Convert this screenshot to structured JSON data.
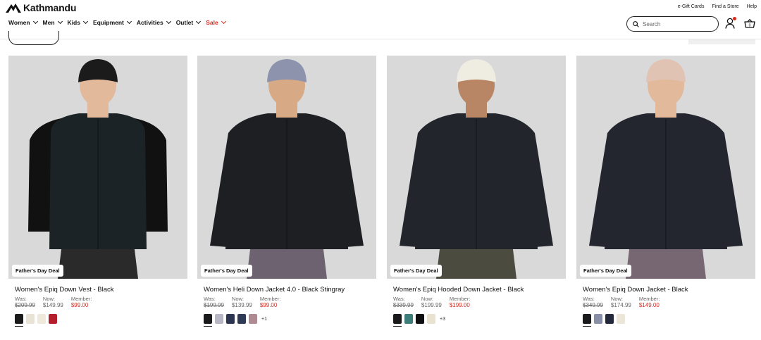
{
  "brand": {
    "name": "Kathmandu"
  },
  "utility_links": [
    "e-Gift Cards",
    "Find a Store",
    "Help"
  ],
  "nav": [
    {
      "label": "Women"
    },
    {
      "label": "Men"
    },
    {
      "label": "Kids"
    },
    {
      "label": "Equipment"
    },
    {
      "label": "Activities"
    },
    {
      "label": "Outlet"
    },
    {
      "label": "Sale"
    }
  ],
  "search": {
    "placeholder": "Search"
  },
  "colors": {
    "accent": "#d52b1e",
    "image_bg": "#d9d9d9"
  },
  "labels": {
    "was": "Was:",
    "now": "Now:",
    "member": "Member:"
  },
  "products": [
    {
      "badge": "Father's Day Deal",
      "title": "Women's Epiq Down Vest - Black",
      "was": "$209.99",
      "now": "$149.99",
      "member": "$99.00",
      "swatches": [
        "#1b1b1b",
        "#e9e3d6",
        "#efe9dc",
        "#b3202b"
      ],
      "more": "",
      "hat": "#1b1b1b",
      "top": "#1c2326",
      "pants": "#2a2a2a",
      "skin": "#e2b99b"
    },
    {
      "badge": "Father's Day Deal",
      "title": "Women's Heli Down Jacket 4.0 - Black Stingray",
      "was": "$199.99",
      "now": "$139.99",
      "member": "$99.00",
      "swatches": [
        "#1a1a1d",
        "#b7b7c6",
        "#2c3550",
        "#2f3a54",
        "#b08a92"
      ],
      "more": "+1",
      "hat": "#8d93ad",
      "top": "#1d1f23",
      "pants": "#6d6370",
      "skin": "#d8a985"
    },
    {
      "badge": "Father's Day Deal",
      "title": "Women's Epiq Hooded Down Jacket - Black",
      "was": "$339.99",
      "now": "$199.99",
      "member": "$199.00",
      "swatches": [
        "#1a1a1d",
        "#3d7e7a",
        "#0f0f12",
        "#eae2d0"
      ],
      "more": "+3",
      "hat": "#efece1",
      "top": "#22262c",
      "pants": "#4b4b3f",
      "skin": "#b88664"
    },
    {
      "badge": "Father's Day Deal",
      "title": "Women's Epiq Down Jacket - Black",
      "was": "$349.99",
      "now": "$174.99",
      "member": "$149.00",
      "swatches": [
        "#1a1a1d",
        "#8a8fa8",
        "#23283a",
        "#ece6d8"
      ],
      "more": "",
      "hat": "#e1c3b4",
      "top": "#23262e",
      "pants": "#766772",
      "skin": "#e2b99b"
    }
  ]
}
